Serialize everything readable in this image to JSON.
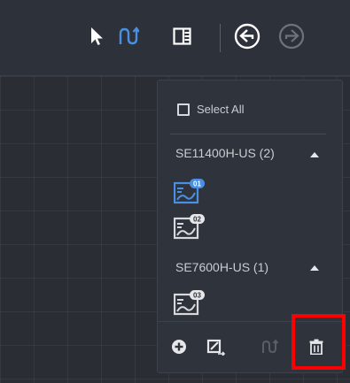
{
  "panel": {
    "select_all_label": "Select All",
    "groups": [
      {
        "name": "SE11400H-US (2)",
        "items": [
          {
            "badge": "01",
            "selected": true
          },
          {
            "badge": "02",
            "selected": false
          }
        ]
      },
      {
        "name": "SE7600H-US (1)",
        "items": [
          {
            "badge": "03",
            "selected": false
          }
        ]
      }
    ]
  },
  "colors": {
    "accent": "#4a90e2",
    "highlight": "#ff0000"
  },
  "icons": {
    "toolbar": [
      "pointer-icon",
      "string-tool-icon",
      "panel-layout-icon",
      "undo-icon",
      "redo-icon"
    ],
    "bottom": [
      "add-icon",
      "edit-array-icon",
      "string-reverse-icon",
      "delete-icon"
    ]
  }
}
